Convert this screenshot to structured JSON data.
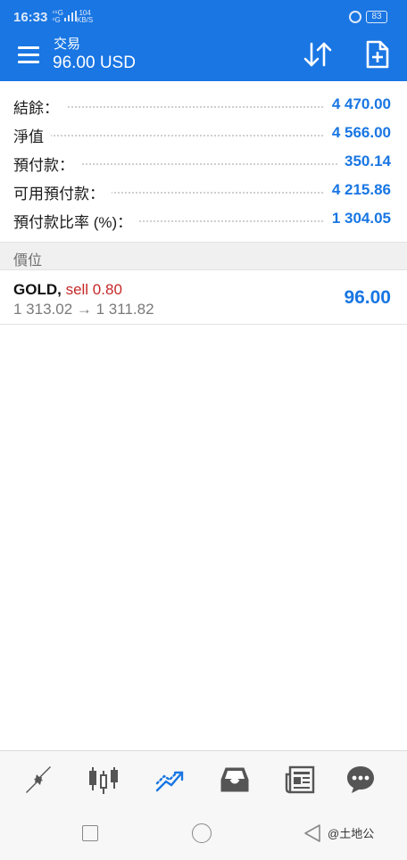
{
  "status_bar": {
    "time": "16:33",
    "net_lines": [
      "⁴⁶G",
      "⁴G"
    ],
    "speed_top": "104",
    "speed_bottom": "KB/S",
    "battery": "83"
  },
  "header": {
    "title": "交易",
    "subtitle": "96.00 USD"
  },
  "summary": [
    {
      "label": "結餘：",
      "value": "4 470.00"
    },
    {
      "label": "淨值",
      "value": "4 566.00"
    },
    {
      "label": "預付款：",
      "value": "350.14"
    },
    {
      "label": "可用預付款：",
      "value": "4 215.86"
    },
    {
      "label": "預付款比率 (%)：",
      "value": "1 304.05"
    }
  ],
  "positions_section": {
    "label": "價位"
  },
  "positions": [
    {
      "symbol": "GOLD,",
      "side": "sell 0.80",
      "prices": "1 313.02 → 1 311.82",
      "profit": "96.00"
    }
  ],
  "bottom_nav": {
    "items": [
      "quotes-arrows-icon",
      "chart-candles-icon",
      "trade-icon",
      "inbox-icon",
      "news-icon",
      "chat-icon"
    ],
    "active": "trade-icon",
    "active_color": "#1976e3",
    "inactive_color": "#555555"
  },
  "watermark": "@土地公",
  "colors": {
    "primary": "#1976e3",
    "sell": "#c62828"
  }
}
